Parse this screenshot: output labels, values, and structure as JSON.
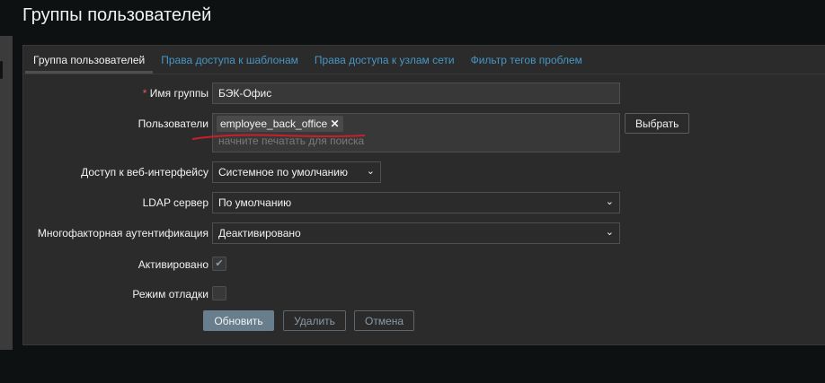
{
  "page_title": "Группы пользователей",
  "tabs": [
    "Группа пользователей",
    "Права доступа к шаблонам",
    "Права доступа к узлам сети",
    "Фильтр тегов проблем"
  ],
  "form": {
    "group_name_label": "Имя группы",
    "required_mark": "*",
    "group_name_value": "БЭК-Офис",
    "users_label": "Пользователи",
    "user_chip": "employee_back_office",
    "users_placeholder": "начните печатать для поиска",
    "select_button": "Выбрать",
    "frontend_label": "Доступ к веб-интерфейсу",
    "frontend_value": "Системное по умолчанию",
    "ldap_label": "LDAP сервер",
    "ldap_value": "По умолчанию",
    "mfa_label": "Многофакторная аутентификация",
    "mfa_value": "Деактивировано",
    "enabled_label": "Активировано",
    "enabled_checked": true,
    "debug_label": "Режим отладки",
    "debug_checked": false
  },
  "buttons": {
    "update": "Обновить",
    "delete": "Удалить",
    "cancel": "Отмена"
  },
  "colors": {
    "link": "#4796c4",
    "annotation": "#c8202a",
    "primary_button": "#687e8c"
  }
}
